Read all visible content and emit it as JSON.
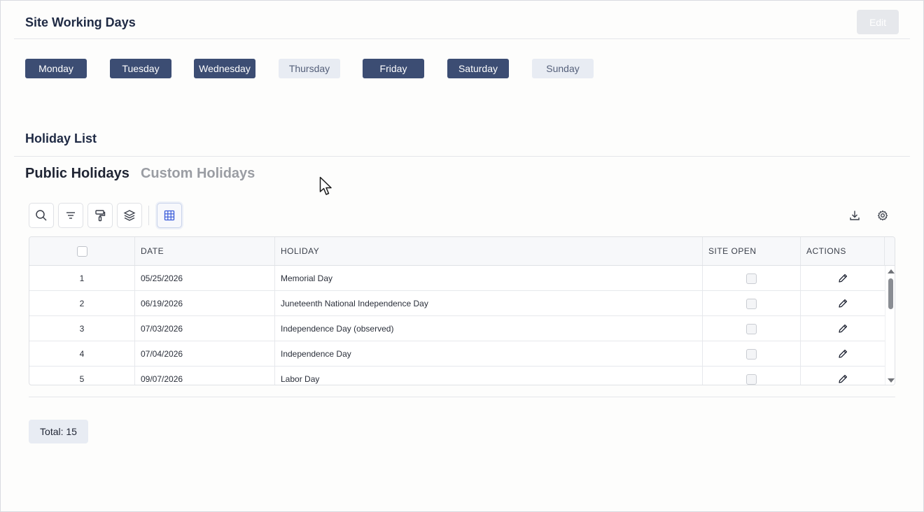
{
  "working_days": {
    "title": "Site Working Days",
    "edit_label": "Edit",
    "days": [
      {
        "label": "Monday",
        "active": true
      },
      {
        "label": "Tuesday",
        "active": true
      },
      {
        "label": "Wednesday",
        "active": true
      },
      {
        "label": "Thursday",
        "active": false
      },
      {
        "label": "Friday",
        "active": true
      },
      {
        "label": "Saturday",
        "active": true
      },
      {
        "label": "Sunday",
        "active": false
      }
    ]
  },
  "holiday_list": {
    "title": "Holiday List",
    "tabs": [
      {
        "label": "Public Holidays",
        "active": true
      },
      {
        "label": "Custom Holidays",
        "active": false
      }
    ]
  },
  "toolbar": {
    "icons": [
      "search-icon",
      "filter-icon",
      "paint-roller-icon",
      "layers-icon",
      "grid-icon",
      "download-icon",
      "gear-icon"
    ]
  },
  "table": {
    "columns": [
      "DATE",
      "HOLIDAY",
      "SITE OPEN",
      "ACTIONS"
    ],
    "rows": [
      {
        "num": "1",
        "date": "05/25/2026",
        "holiday": "Memorial Day"
      },
      {
        "num": "2",
        "date": "06/19/2026",
        "holiday": "Juneteenth National Independence Day"
      },
      {
        "num": "3",
        "date": "07/03/2026",
        "holiday": "Independence Day (observed)"
      },
      {
        "num": "4",
        "date": "07/04/2026",
        "holiday": "Independence Day"
      },
      {
        "num": "5",
        "date": "09/07/2026",
        "holiday": "Labor Day"
      }
    ]
  },
  "total_label": "Total: 15",
  "colors": {
    "active_day": "#3c4d73",
    "inactive_day": "#e8ecf3",
    "accent_blue": "#3a5bd9"
  }
}
